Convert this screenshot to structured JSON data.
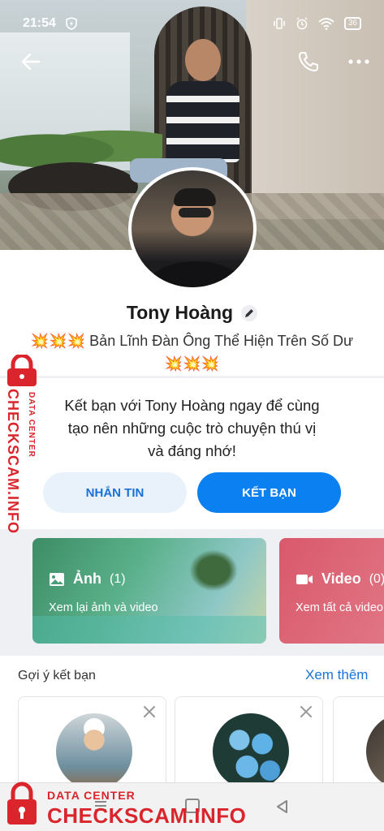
{
  "status_bar": {
    "time": "21:54",
    "battery": "36"
  },
  "profile": {
    "name": "Tony Hoàng",
    "bio_line1": "Bản Lĩnh Đàn Ông Thể Hiện Trên Số Dư",
    "bio_emoji": "💥💥💥"
  },
  "invite": {
    "line1": "Kết bạn với Tony Hoàng ngay để cùng",
    "line2": "tạo nên những cuộc trò chuyện thú vị",
    "line3": "và đáng nhớ!",
    "message_label": "NHẮN TIN",
    "add_friend_label": "KẾT BẠN"
  },
  "media": {
    "photos": {
      "label": "Ảnh",
      "count": "(1)",
      "sub": "Xem lại ảnh và video"
    },
    "videos": {
      "label": "Video",
      "count": "(0)",
      "sub": "Xem tất cả video"
    }
  },
  "suggestions": {
    "title": "Gợi ý kết bạn",
    "see_more": "Xem thêm"
  },
  "watermark": {
    "brand": "CHECKSCAM.INFO",
    "tag": "DATA CENTER"
  },
  "colors": {
    "accent": "#0b80f0",
    "watermark": "#d9252b",
    "link": "#1a73d9"
  }
}
